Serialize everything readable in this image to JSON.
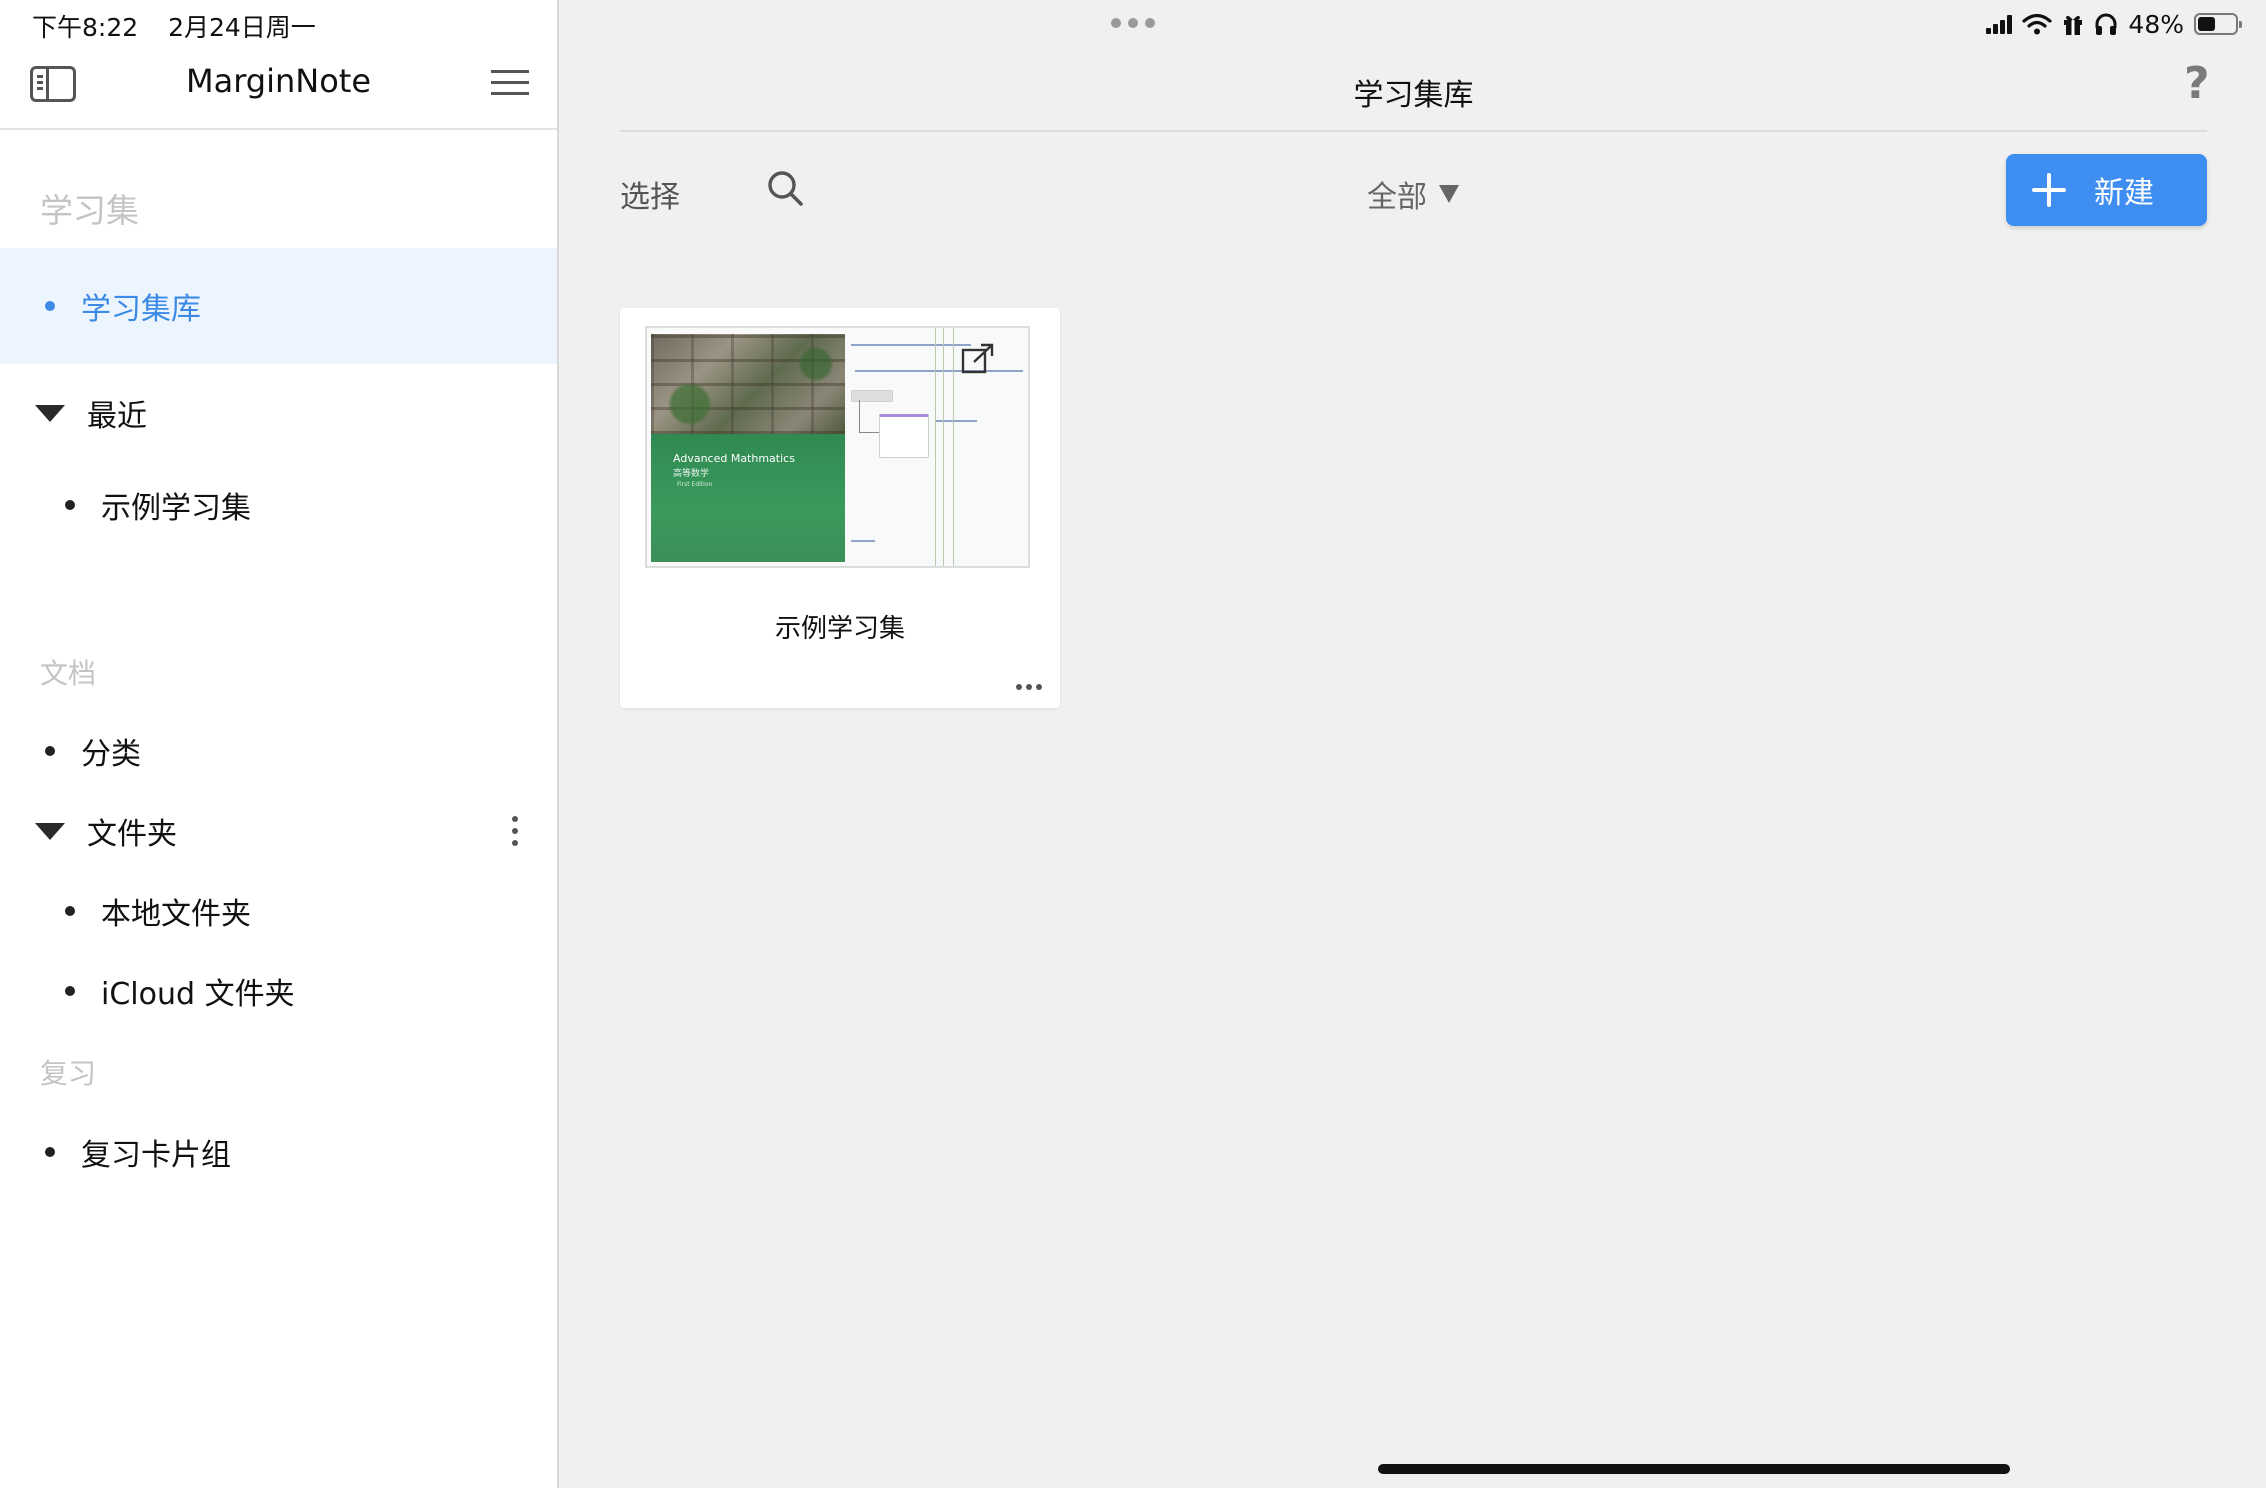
{
  "status_bar": {
    "time": "下午8:22",
    "date": "2月24日周一",
    "battery_text": "48%",
    "battery_level": 0.48
  },
  "sidebar": {
    "app_title": "MarginNote",
    "section_study": "学习集",
    "study_items": [
      {
        "label": "学习集库",
        "active": true
      }
    ],
    "recent_label": "最近",
    "recent_items": [
      {
        "label": "示例学习集"
      }
    ],
    "section_docs": "文档",
    "docs_items": [
      {
        "label": "分类"
      }
    ],
    "folders_label": "文件夹",
    "folder_items": [
      {
        "label": "本地文件夹"
      },
      {
        "label": "iCloud 文件夹"
      }
    ],
    "section_review": "复习",
    "review_items": [
      {
        "label": "复习卡片组"
      }
    ]
  },
  "main": {
    "title": "学习集库",
    "help": "?",
    "select_label": "选择",
    "filter_label": "全部",
    "new_button_label": "新建",
    "cards": [
      {
        "title": "示例学习集",
        "cover_title": "Advanced Mathmatics",
        "cover_subtitle": "高等数学",
        "cover_edition": "First Edition"
      }
    ]
  },
  "colors": {
    "accent": "#3d8ef0",
    "active_text": "#3b8ae6",
    "active_bg": "#ecf4fd"
  },
  "icons": {
    "sidebar_toggle": "sidebar-toggle-icon",
    "menu": "hamburger-menu-icon",
    "search": "search-icon",
    "new": "plus-icon",
    "more": "more-horizontal-icon",
    "folder_more": "more-vertical-icon",
    "help": "question-mark-icon",
    "share": "open-external-icon"
  }
}
